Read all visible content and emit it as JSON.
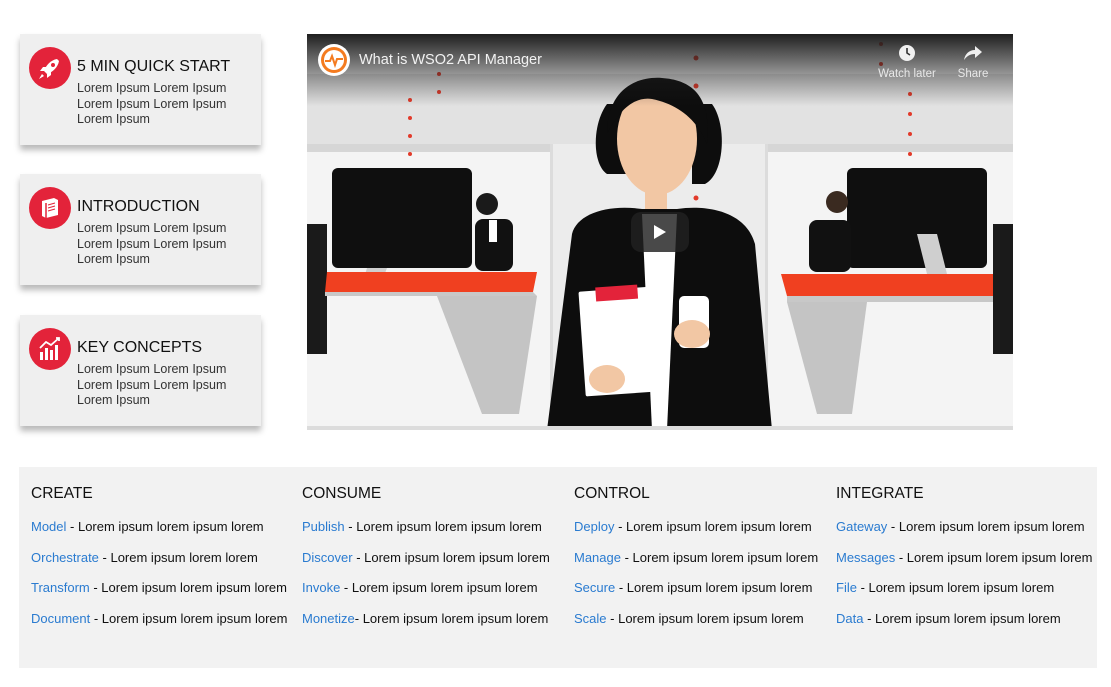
{
  "cards": [
    {
      "title": "5 MIN QUICK START",
      "desc": "Lorem Ipsum Lorem Ipsum Lorem Ipsum Lorem Ipsum Lorem Ipsum",
      "icon": "rocket-icon"
    },
    {
      "title": "INTRODUCTION",
      "desc": "Lorem Ipsum Lorem Ipsum Lorem Ipsum Lorem Ipsum Lorem Ipsum",
      "icon": "book-icon"
    },
    {
      "title": "KEY CONCEPTS",
      "desc": "Lorem Ipsum Lorem Ipsum Lorem Ipsum Lorem Ipsum Lorem Ipsum",
      "icon": "chart-icon"
    }
  ],
  "video": {
    "title": "What is WSO2 API Manager",
    "watch_later": "Watch later",
    "share": "Share",
    "channel_icon": "wso2-pulse-icon"
  },
  "colors": {
    "accent": "#e3233a",
    "link": "#2a7bd0",
    "panel": "#f2f2f2"
  },
  "columns": [
    {
      "heading": "CREATE",
      "items": [
        {
          "link": "Model",
          "text": " - Lorem ipsum lorem ipsum lorem"
        },
        {
          "link": "Orchestrate",
          "text": " - Lorem ipsum lorem lorem"
        },
        {
          "link": "Transform",
          "text": " - Lorem ipsum lorem ipsum lorem"
        },
        {
          "link": "Document",
          "text": " - Lorem ipsum lorem ipsum lorem"
        }
      ]
    },
    {
      "heading": "CONSUME",
      "items": [
        {
          "link": "Publish",
          "text": " - Lorem ipsum lorem ipsum lorem"
        },
        {
          "link": "Discover",
          "text": " - Lorem ipsum lorem ipsum lorem"
        },
        {
          "link": "Invoke",
          "text": " - Lorem ipsum lorem ipsum lorem"
        },
        {
          "link": "Monetize",
          "text": "- Lorem ipsum lorem ipsum lorem"
        }
      ]
    },
    {
      "heading": "CONTROL",
      "items": [
        {
          "link": "Deploy",
          "text": " - Lorem ipsum lorem ipsum lorem"
        },
        {
          "link": "Manage",
          "text": " - Lorem ipsum lorem ipsum lorem"
        },
        {
          "link": "Secure",
          "text": " - Lorem ipsum lorem ipsum lorem"
        },
        {
          "link": "Scale",
          "text": " - Lorem ipsum lorem ipsum lorem"
        }
      ]
    },
    {
      "heading": "INTEGRATE",
      "items": [
        {
          "link": "Gateway",
          "text": " - Lorem ipsum lorem ipsum lorem"
        },
        {
          "link": "Messages",
          "text": " - Lorem ipsum lorem ipsum lorem"
        },
        {
          "link": "File",
          "text": " - Lorem ipsum lorem ipsum lorem"
        },
        {
          "link": "Data",
          "text": " - Lorem ipsum lorem ipsum lorem"
        }
      ]
    }
  ]
}
